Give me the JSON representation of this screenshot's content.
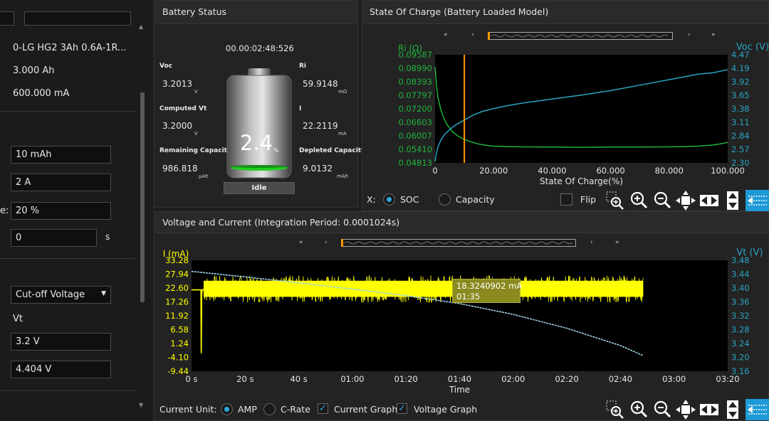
{
  "left": {
    "cell_name": "0-LG HG2 3Ah 0.6A-1R...",
    "capacity": "3.000 Ah",
    "current": "600.000 mA",
    "step_capacity": "10 mAh",
    "step_current": "2 A",
    "rate_prefix": "e:",
    "rate_value": "20 %",
    "time_value": "0",
    "time_unit": "s",
    "cutoff_select": "Cut-off Voltage",
    "vt_label": "Vt",
    "vt_low": "3.2 V",
    "vt_high": "4.404 V"
  },
  "battery_status": {
    "title": "Battery Status",
    "elapsed": "00.00:02:48:526",
    "voc_label": "Voc",
    "voc_value": "3.2013",
    "voc_unit": "V",
    "computed_vt_label": "Computed Vt",
    "computed_vt_value": "3.2000",
    "computed_vt_unit": "V",
    "remaining_label": "Remaining Capacity",
    "remaining_value": "986.818",
    "remaining_unit": "µAh",
    "ri_label": "Ri",
    "ri_value": "59.9148",
    "ri_unit": "mΩ",
    "i_label": "I",
    "i_value": "22.2119",
    "i_unit": "mA",
    "depleted_label": "Depleted Capacity",
    "depleted_value": "9.0132",
    "depleted_unit": "mAh",
    "gauge_value": "2.4",
    "gauge_pct": "%",
    "state": "Idle"
  },
  "soc_panel": {
    "title": "State Of Charge (Battery Loaded Model)",
    "x_label": "X:",
    "radio_soc": "SOC",
    "radio_capacity": "Capacity",
    "flip_label": "Flip"
  },
  "vc_panel": {
    "title": "Voltage and Current (Integration Period: 0.0001024s)",
    "current_unit_label": "Current Unit:",
    "radio_amp": "AMP",
    "radio_crate": "C-Rate",
    "check_current": "Current Graph",
    "check_voltage": "Voltage Graph",
    "tooltip_value": "18.3240902 mA",
    "tooltip_time": "01:35"
  },
  "colors": {
    "ri": "#1fb33a",
    "voc": "#2aa3c2",
    "current": "#ffff00",
    "vt": "#9ed3e6",
    "cursor": "#ff9900",
    "accent": "#2ea8e0"
  },
  "chart_data": [
    {
      "type": "line",
      "title": "",
      "xlabel": "State Of Charge(%)",
      "x_ticks": [
        "0",
        "20.000",
        "40.000",
        "60.000",
        "80.000",
        "100.000"
      ],
      "xlim": [
        0,
        100
      ],
      "y_left_label": "Ri (Ω)",
      "y_left_ticks": [
        "0.09587",
        "0.08990",
        "0.08393",
        "0.07797",
        "0.07200",
        "0.06603",
        "0.06007",
        "0.05410",
        "0.04813"
      ],
      "y_left_range": [
        0.04813,
        0.09587
      ],
      "y_right_label": "Voc (V)",
      "y_right_ticks": [
        "4.47",
        "4.19",
        "3.92",
        "3.65",
        "3.38",
        "3.11",
        "2.84",
        "2.57",
        "2.30"
      ],
      "y_right_range": [
        2.3,
        4.47
      ],
      "cursor_x": 10,
      "series": [
        {
          "name": "Ri (Ω)",
          "axis": "left",
          "x": [
            0,
            0.5,
            1,
            2,
            3,
            4,
            6,
            8,
            10,
            12,
            15,
            18,
            20,
            25,
            30,
            40,
            50,
            60,
            70,
            80,
            85,
            90,
            95,
            98,
            100
          ],
          "values": [
            0.0905,
            0.082,
            0.077,
            0.0715,
            0.068,
            0.0652,
            0.0618,
            0.0598,
            0.0585,
            0.0575,
            0.0564,
            0.0558,
            0.0555,
            0.0553,
            0.0552,
            0.0551,
            0.055,
            0.0551,
            0.0551,
            0.0552,
            0.0553,
            0.0555,
            0.056,
            0.0566,
            0.0572
          ]
        },
        {
          "name": "Voc (V)",
          "axis": "right",
          "x": [
            0,
            0.5,
            1,
            2,
            3,
            5,
            7,
            10,
            13,
            16,
            20,
            25,
            30,
            40,
            50,
            60,
            70,
            80,
            90,
            95,
            100
          ],
          "values": [
            2.33,
            2.5,
            2.62,
            2.76,
            2.85,
            2.97,
            3.06,
            3.16,
            3.26,
            3.33,
            3.39,
            3.45,
            3.5,
            3.58,
            3.66,
            3.75,
            3.86,
            3.97,
            4.08,
            4.11,
            4.17
          ]
        }
      ]
    },
    {
      "type": "line",
      "title": "",
      "xlabel": "Time",
      "x_ticks": [
        "0 s",
        "20 s",
        "40 s",
        "01:00",
        "01:20",
        "01:40",
        "02:00",
        "02:20",
        "02:40",
        "03:00",
        "03:20"
      ],
      "xlim": [
        0,
        200
      ],
      "y_left_label": "I (mA)",
      "y_left_ticks": [
        "33.28",
        "27.94",
        "22.60",
        "17.26",
        "11.92",
        "6.58",
        "1.24",
        "-4.10",
        "-9.44"
      ],
      "y_left_range": [
        -9.44,
        33.28
      ],
      "y_right_label": "Vt (V)",
      "y_right_ticks": [
        "3.48",
        "3.44",
        "3.40",
        "3.36",
        "3.32",
        "3.28",
        "3.24",
        "3.20",
        "3.16"
      ],
      "y_right_range": [
        3.16,
        3.48
      ],
      "series": [
        {
          "name": "Current Graph",
          "axis": "left",
          "x": [
            0,
            3.5,
            3.6,
            3.8,
            4.0,
            4.3,
            4.5,
            168.5
          ],
          "values": [
            21.9,
            21.9,
            -2.5,
            20.0,
            22.0,
            21.9,
            22.0,
            22.0
          ],
          "noise_band": [
            17.0,
            27.5
          ]
        },
        {
          "name": "Voltage Graph",
          "axis": "right",
          "x": [
            0,
            20,
            40,
            60,
            80,
            100,
            120,
            140,
            160,
            168.5
          ],
          "values": [
            3.448,
            3.432,
            3.415,
            3.397,
            3.378,
            3.355,
            3.324,
            3.284,
            3.234,
            3.205
          ]
        }
      ]
    }
  ]
}
